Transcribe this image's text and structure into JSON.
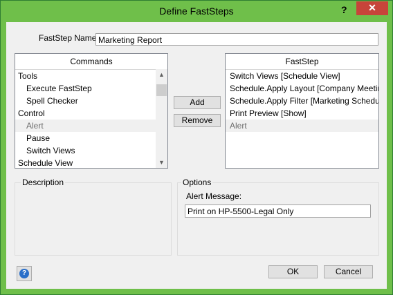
{
  "window": {
    "title": "Define FastSteps",
    "help_glyph": "?",
    "close_glyph": "✕"
  },
  "name_field": {
    "label": "FastStep Name:",
    "value": "Marketing Report"
  },
  "commands": {
    "header": "Commands",
    "items": [
      {
        "label": "Tools",
        "indent": false,
        "selected": false
      },
      {
        "label": "Execute FastStep",
        "indent": true,
        "selected": false
      },
      {
        "label": "Spell Checker",
        "indent": true,
        "selected": false
      },
      {
        "label": "Control",
        "indent": false,
        "selected": false
      },
      {
        "label": "Alert",
        "indent": true,
        "selected": true
      },
      {
        "label": "Pause",
        "indent": true,
        "selected": false
      },
      {
        "label": "Switch Views",
        "indent": true,
        "selected": false
      },
      {
        "label": "Schedule View",
        "indent": false,
        "selected": false
      }
    ]
  },
  "buttons": {
    "add": "Add",
    "remove": "Remove",
    "ok": "OK",
    "cancel": "Cancel"
  },
  "faststep": {
    "header": "FastStep",
    "items": [
      {
        "label": "Switch Views [Schedule View]",
        "selected": false
      },
      {
        "label": "Schedule.Apply Layout [Company Meeting...",
        "selected": false
      },
      {
        "label": "Schedule.Apply Filter [Marketing Schedule]",
        "selected": false
      },
      {
        "label": "Print Preview [Show]",
        "selected": false
      },
      {
        "label": "Alert",
        "selected": true
      }
    ]
  },
  "description": {
    "label": "Description"
  },
  "options": {
    "label": "Options",
    "alert_label": "Alert Message:",
    "alert_value": "Print on HP-5500-Legal Only"
  },
  "colors": {
    "title_bar": "#6fbf4a",
    "close_button": "#c7443a"
  }
}
